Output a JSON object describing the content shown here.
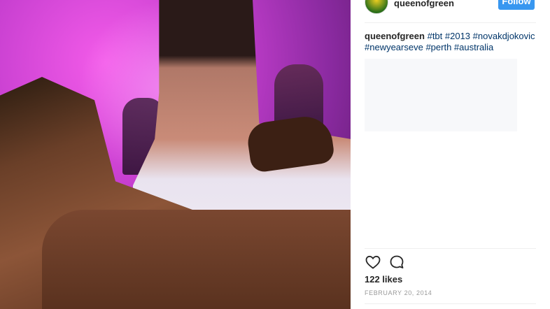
{
  "header": {
    "username": "queenofgreen",
    "follow_label": "Follow"
  },
  "caption": {
    "username": "queenofgreen",
    "tags": "#tbt #2013 #novakdjokovic #newyearseve #perth #australia"
  },
  "actions": {
    "like_icon": "heart-icon",
    "comment_icon": "comment-icon"
  },
  "likes": "122 likes",
  "date": "FEBRUARY 20, 2014",
  "colors": {
    "follow_button": "#3897f0",
    "hashtag": "#003569",
    "text": "#262626",
    "muted": "#999999"
  }
}
